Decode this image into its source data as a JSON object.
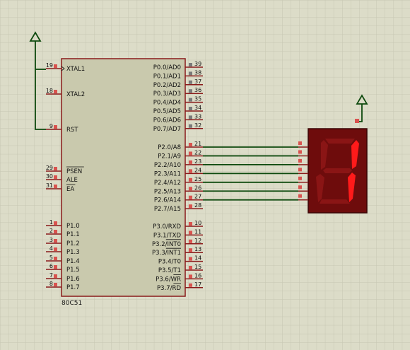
{
  "chip": {
    "name": "80C51",
    "left_pins": [
      {
        "num": "19",
        "label": "XTAL1",
        "clock": true
      },
      {
        "num": "18",
        "label": "XTAL2"
      },
      {
        "num": "9",
        "label": "RST"
      },
      {
        "num": "29",
        "label": "PSEN",
        "overline": true
      },
      {
        "num": "30",
        "label": "ALE"
      },
      {
        "num": "31",
        "label": "EA",
        "overline": true
      },
      {
        "num": "1",
        "label": "P1.0"
      },
      {
        "num": "2",
        "label": "P1.1"
      },
      {
        "num": "3",
        "label": "P1.2"
      },
      {
        "num": "4",
        "label": "P1.3"
      },
      {
        "num": "5",
        "label": "P1.4"
      },
      {
        "num": "6",
        "label": "P1.5"
      },
      {
        "num": "7",
        "label": "P1.6"
      },
      {
        "num": "8",
        "label": "P1.7"
      }
    ],
    "right_pins": [
      {
        "num": "39",
        "label": "P0.0/AD0"
      },
      {
        "num": "38",
        "label": "P0.1/AD1"
      },
      {
        "num": "37",
        "label": "P0.2/AD2"
      },
      {
        "num": "36",
        "label": "P0.3/AD3"
      },
      {
        "num": "35",
        "label": "P0.4/AD4"
      },
      {
        "num": "34",
        "label": "P0.5/AD5"
      },
      {
        "num": "33",
        "label": "P0.6/AD6"
      },
      {
        "num": "32",
        "label": "P0.7/AD7"
      },
      {
        "num": "21",
        "label": "P2.0/A8"
      },
      {
        "num": "22",
        "label": "P2.1/A9"
      },
      {
        "num": "23",
        "label": "P2.2/A10"
      },
      {
        "num": "24",
        "label": "P2.3/A11"
      },
      {
        "num": "25",
        "label": "P2.4/A12"
      },
      {
        "num": "26",
        "label": "P2.5/A13"
      },
      {
        "num": "27",
        "label": "P2.6/A14"
      },
      {
        "num": "28",
        "label": "P2.7/A15"
      },
      {
        "num": "10",
        "label": "P3.0/RXD"
      },
      {
        "num": "11",
        "label": "P3.1/TXD"
      },
      {
        "num": "12",
        "label": "P3.2/INT0",
        "overline_part": "INT0"
      },
      {
        "num": "13",
        "label": "P3.3/INT1",
        "overline_part": "INT1"
      },
      {
        "num": "14",
        "label": "P3.4/T0"
      },
      {
        "num": "15",
        "label": "P3.5/T1"
      },
      {
        "num": "16",
        "label": "P3.6/WR",
        "overline_part": "WR"
      },
      {
        "num": "17",
        "label": "P3.7/RD",
        "overline_part": "RD"
      }
    ]
  },
  "display": {
    "digit": "1",
    "segment_color": "#ff1a1a",
    "body_color": "#6e0c0c"
  },
  "colors": {
    "background": "#dcdcc8",
    "grid": "#c4c4b0",
    "chip_fill": "#c9c9ad",
    "chip_border": "#8a1a1a",
    "wire": "#0e4a0e",
    "pin_square": "#d9534f",
    "pin_square_grey": "#7a7a7a"
  }
}
